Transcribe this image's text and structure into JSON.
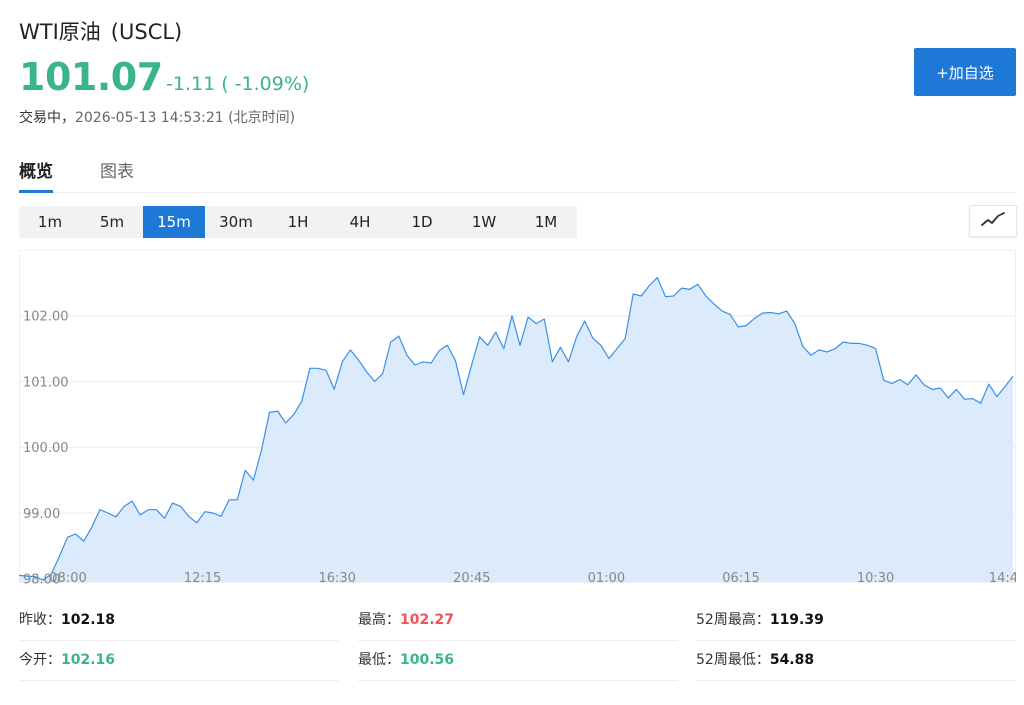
{
  "header": {
    "name": "WTI原油",
    "code": "(USCL)",
    "price": "101.07",
    "change": "-1.11 ( -1.09%)",
    "status_label": "交易中，",
    "datetime": "2026-05-13 14:53:21",
    "timezone": "(北京时间)",
    "add_button": "+加自选"
  },
  "tabs": [
    "概览",
    "图表"
  ],
  "periods": [
    "1m",
    "5m",
    "15m",
    "30m",
    "1H",
    "4H",
    "1D",
    "1W",
    "1M"
  ],
  "active_period": "15m",
  "chart_data": {
    "type": "area",
    "x_tick_labels": [
      "08:00",
      "12:15",
      "16:30",
      "20:45",
      "01:00",
      "06:15",
      "10:30",
      "14:4"
    ],
    "y_tick_labels": [
      "98.00",
      "99.00",
      "100.00",
      "101.00",
      "102.00"
    ],
    "ylim": [
      97.95,
      103.0
    ],
    "grid": true,
    "values": [
      98.05,
      98.04,
      98.03,
      97.98,
      98.07,
      98.34,
      98.63,
      98.68,
      98.57,
      98.78,
      99.05,
      99.0,
      98.94,
      99.1,
      99.18,
      98.97,
      99.05,
      99.05,
      98.92,
      99.15,
      99.1,
      98.95,
      98.85,
      99.02,
      99.0,
      98.95,
      99.2,
      99.2,
      99.65,
      99.5,
      99.95,
      100.53,
      100.55,
      100.37,
      100.5,
      100.7,
      101.2,
      101.2,
      101.17,
      100.88,
      101.3,
      101.48,
      101.33,
      101.15,
      101.0,
      101.12,
      101.6,
      101.69,
      101.4,
      101.25,
      101.3,
      101.28,
      101.47,
      101.55,
      101.32,
      100.8,
      101.25,
      101.68,
      101.55,
      101.75,
      101.5,
      102.0,
      101.55,
      101.98,
      101.88,
      101.95,
      101.3,
      101.52,
      101.3,
      101.68,
      101.92,
      101.66,
      101.55,
      101.35,
      101.5,
      101.65,
      102.33,
      102.3,
      102.46,
      102.58,
      102.29,
      102.3,
      102.42,
      102.4,
      102.48,
      102.3,
      102.18,
      102.07,
      102.02,
      101.83,
      101.85,
      101.96,
      102.04,
      102.05,
      102.03,
      102.07,
      101.88,
      101.53,
      101.4,
      101.48,
      101.45,
      101.5,
      101.6,
      101.58,
      101.58,
      101.55,
      101.5,
      101.02,
      100.97,
      101.03,
      100.95,
      101.1,
      100.95,
      100.88,
      100.9,
      100.75,
      100.88,
      100.73,
      100.74,
      100.67,
      100.96,
      100.77,
      100.92,
      101.08
    ],
    "line_color": "#3a90e5",
    "fill_color": "#dcebfb"
  },
  "stats": [
    [
      {
        "label": "昨收：",
        "value": "102.18",
        "color": "dark"
      },
      {
        "label": "最高：",
        "value": "102.27",
        "color": "red"
      },
      {
        "label": "52周最高：",
        "value": "119.39",
        "color": "dark"
      }
    ],
    [
      {
        "label": "今开：",
        "value": "102.16",
        "color": "green"
      },
      {
        "label": "最低：",
        "value": "100.56",
        "color": "green"
      },
      {
        "label": "52周最低：",
        "value": "54.88",
        "color": "dark"
      }
    ]
  ]
}
